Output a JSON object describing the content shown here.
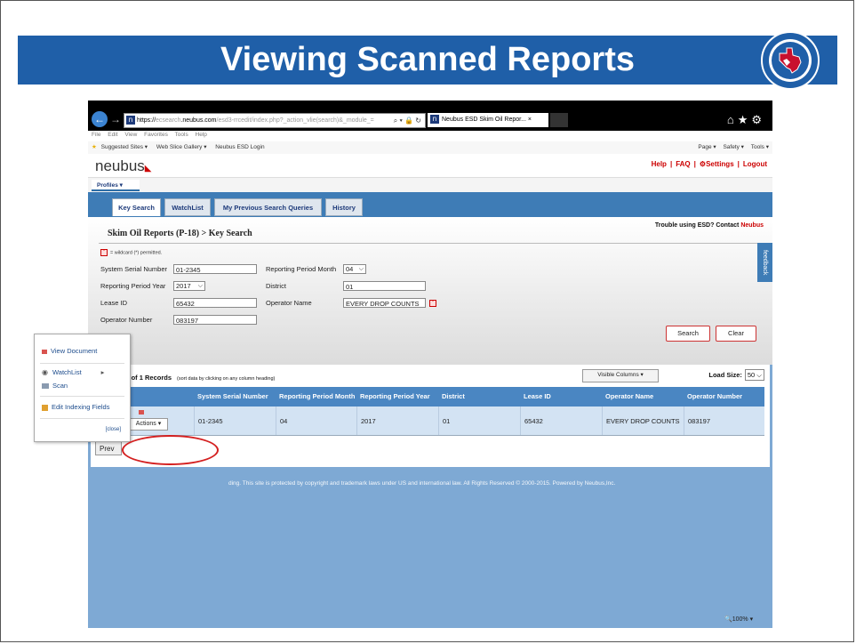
{
  "slide": {
    "title": "Viewing Scanned Reports"
  },
  "seal": {
    "text_top": "RAILROAD COMMISSION",
    "text_side": "OF TEXAS"
  },
  "browser": {
    "address_https": "https://",
    "address_dim": "ecsearch",
    "address_host": ".neubus.com",
    "address_rest": "/esd3-rrcedit/index.php?_action_vlie(search)&_module_=",
    "tab_title": "Neubus ESD Skim Oil Repor...",
    "menu_items": [
      "File",
      "Edit",
      "View",
      "Favorites",
      "Tools",
      "Help"
    ],
    "favorites": [
      "Suggested Sites ▾",
      "Web Slice Gallery ▾",
      "Neubus ESD Login"
    ],
    "command_items": [
      "Page ▾",
      "Safety ▾",
      "Tools ▾"
    ],
    "zoom": "100%"
  },
  "app": {
    "logo": "neubus",
    "links": {
      "help": "Help",
      "faq": "FAQ",
      "settings": "Settings",
      "logout": "Logout"
    },
    "profiles": "Profiles",
    "tabs": [
      "Key Search",
      "WatchList",
      "My Previous Search Queries",
      "History"
    ],
    "trouble_prefix": "Trouble using ESD? Contact ",
    "trouble_link": "Neubus",
    "page_title": "Skim Oil Reports (P-18) > Key Search",
    "wildcard_note": "= wildcard (*) permitted.",
    "feedback": "feedback"
  },
  "form": {
    "system_serial_number": {
      "label": "System Serial Number",
      "value": "01-2345"
    },
    "reporting_period_year": {
      "label": "Reporting Period Year",
      "value": "2017"
    },
    "lease_id": {
      "label": "Lease ID",
      "value": "65432"
    },
    "operator_number": {
      "label": "Operator Number",
      "value": "083197"
    },
    "reporting_period_month": {
      "label": "Reporting Period Month",
      "value": "04"
    },
    "district": {
      "label": "District",
      "value": "01"
    },
    "operator_name": {
      "label": "Operator Name",
      "value": "EVERY DROP COUNTS"
    },
    "search_button": "Search",
    "clear_button": "Clear"
  },
  "results": {
    "showing": "Showing 1 of 1 Records",
    "sort_hint": "(sort data by clicking on any column heading)",
    "visible_columns": "Visible Columns",
    "load_size_label": "Load Size:",
    "load_size_value": "50",
    "columns": [
      "System Serial Number",
      "Reporting Period Month",
      "Reporting Period Year",
      "District",
      "Lease ID",
      "Operator Name",
      "Operator Number"
    ],
    "row": [
      "01-2345",
      "04",
      "2017",
      "01",
      "65432",
      "EVERY DROP COUNTS",
      "083197"
    ],
    "actions_button": "Actions",
    "prev_button": "Prev"
  },
  "actions_menu": {
    "view_document": "View Document",
    "watchlist": "WatchList",
    "scan": "Scan",
    "edit_indexing_fields": "Edit Indexing Fields",
    "close": "[close]"
  },
  "footer": {
    "text": "ding. This site is protected by copyright and trademark laws under US and international law. All Rights Reserved © 2000-2015. Powered by Neubus,Inc."
  },
  "colors": {
    "slide_title_bar": "#1f5fa8",
    "app_blue": "#3e7cb6",
    "table_header": "#4a86c2",
    "accent_red": "#c00000",
    "highlight_ellipse": "#d42020"
  },
  "icons": [
    "back-arrow-icon",
    "forward-arrow-icon",
    "search-icon",
    "lock-icon",
    "refresh-icon",
    "home-icon",
    "favorites-star-icon",
    "gear-icon",
    "document-icon",
    "eye-icon",
    "scan-icon",
    "edit-icon",
    "chevron-down-icon"
  ]
}
